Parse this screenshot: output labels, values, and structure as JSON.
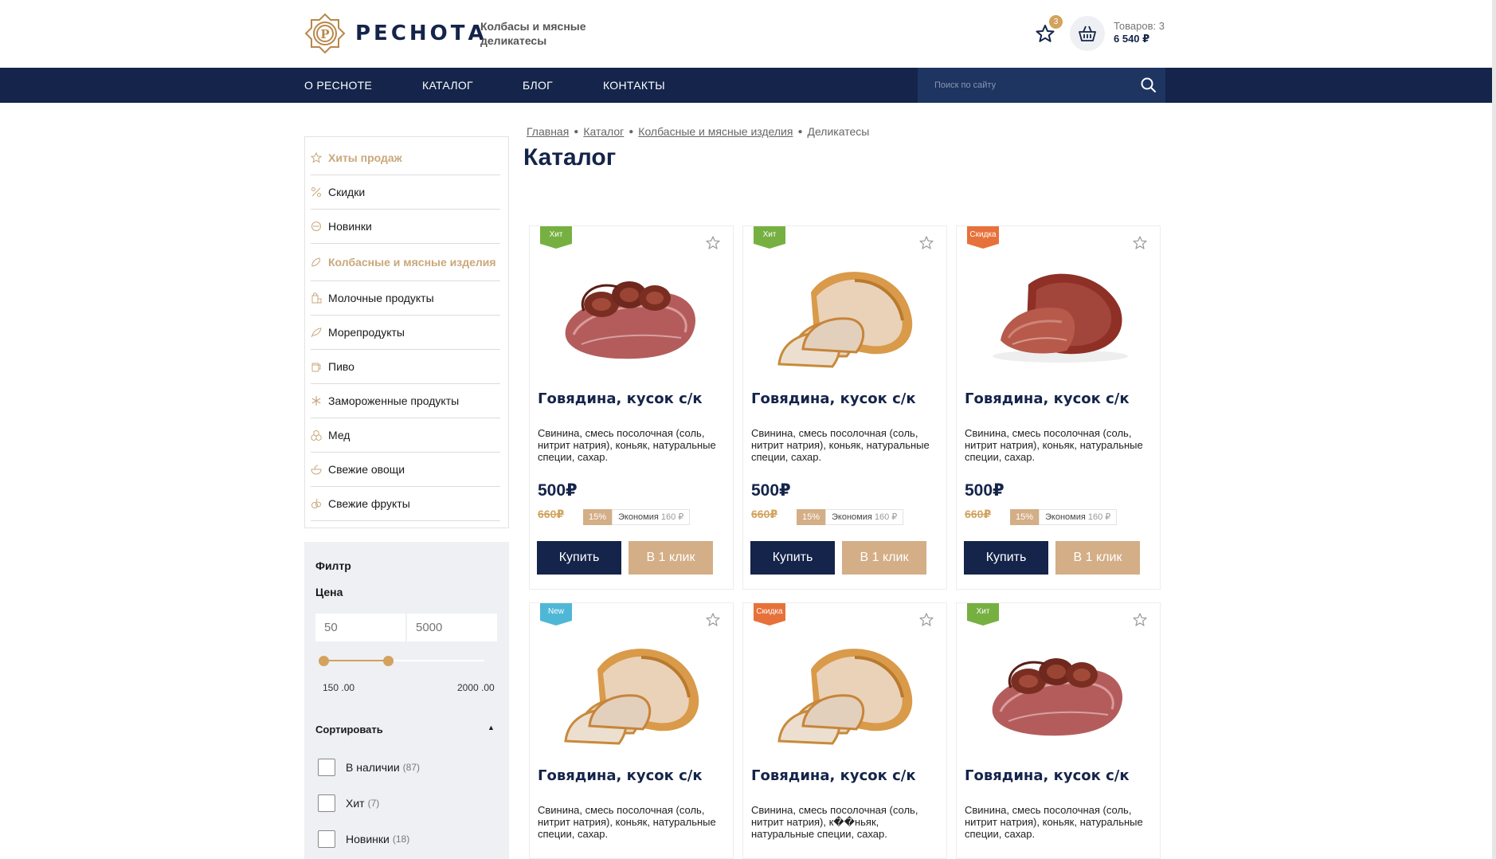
{
  "header": {
    "logo_text": "РЕСНОТА",
    "tagline": "Колбасы и мясные деликатесы",
    "favorites_count": "3",
    "cart_count": "Товаров: 3",
    "cart_sum": "6 540 ₽"
  },
  "nav": {
    "items": [
      "О РЕСНОТЕ",
      "КАТАЛОГ",
      "БЛОГ",
      "КОНТАКТЫ"
    ],
    "search_placeholder": "Поиск по сайту"
  },
  "sidebar": {
    "items": [
      {
        "label": "Хиты продаж",
        "icon": "star-icon",
        "accent": true
      },
      {
        "label": "Скидки",
        "icon": "percent-icon",
        "accent": false
      },
      {
        "label": "Новинки",
        "icon": "new-icon",
        "accent": false
      },
      {
        "label": "Колбасные и мясные изделия",
        "icon": "sausage-icon",
        "accent": true
      },
      {
        "label": "Молочные продукты",
        "icon": "milk-icon",
        "accent": false
      },
      {
        "label": "Морепродукты",
        "icon": "fish-icon",
        "accent": false
      },
      {
        "label": "Пиво",
        "icon": "beer-icon",
        "accent": false
      },
      {
        "label": "Замороженные продукты",
        "icon": "snowflake-icon",
        "accent": false
      },
      {
        "label": "Мед",
        "icon": "honey-icon",
        "accent": false
      },
      {
        "label": "Свежие овощи",
        "icon": "vegetables-icon",
        "accent": false
      },
      {
        "label": "Свежие фрукты",
        "icon": "fruits-icon",
        "accent": false
      }
    ]
  },
  "filter": {
    "title": "Филтр",
    "price_label": "Цена",
    "price_min_placeholder": "50",
    "price_max_placeholder": "5000",
    "slider_min_label": "150 .00",
    "slider_max_label": "2000 .00",
    "sort_label": "Сортировать",
    "checkboxes": [
      {
        "label": "В наличии",
        "count": "(87)"
      },
      {
        "label": "Хит",
        "count": "(7)"
      },
      {
        "label": "Новинки",
        "count": "(18)"
      }
    ]
  },
  "breadcrumb": [
    "Главная",
    "Каталог",
    "Колбасные и мясные изделия",
    "Деликатесы"
  ],
  "page_title": "Каталог",
  "products": [
    {
      "badge": "Хит",
      "badge_type": "hit",
      "image": "anchovy",
      "name": "Говядина, кусок с/к",
      "desc": "Свинина, смесь посолочная (соль, нитрит натрия), коньяк, натуральные специи, сахар.",
      "price": "500₽",
      "old_price": "660₽",
      "discount": "15%",
      "save_label": "Экономия",
      "save_amount": "160 ₽",
      "buy_label": "Купить",
      "oneclick_label": "В 1 клик"
    },
    {
      "badge": "Хит",
      "badge_type": "hit",
      "image": "ham",
      "name": "Говядина, кусок с/к",
      "desc": "Свинина, смесь посолочная (соль, нитрит натрия), коньяк, натуральные специи, сахар.",
      "price": "500₽",
      "old_price": "660₽",
      "discount": "15%",
      "save_label": "Экономия",
      "save_amount": "160 ₽",
      "buy_label": "Купить",
      "oneclick_label": "В 1 клик"
    },
    {
      "badge": "Скидка",
      "badge_type": "sale",
      "image": "beef",
      "name": "Говядина, кусок с/к",
      "desc": "Свинина, смесь посолочная (соль, нитрит натрия), коньяк, натуральные специи, сахар.",
      "price": "500₽",
      "old_price": "660₽",
      "discount": "15%",
      "save_label": "Экономия",
      "save_amount": "160 ₽",
      "buy_label": "Купить",
      "oneclick_label": "В 1 клик"
    },
    {
      "badge": "New",
      "badge_type": "new",
      "image": "ham",
      "name": "Говядина, кусок с/к",
      "desc": "Свинина, смесь посолочная (соль, нитрит натрия), коньяк, натуральные специи, сахар."
    },
    {
      "badge": "Скидка",
      "badge_type": "sale",
      "image": "ham",
      "name": "Говядина, кусок с/к",
      "desc": "Свинина, смесь посолочная (соль, нитрит натрия), к��ньяк, натуральные специи, сахар."
    },
    {
      "badge": "Хит",
      "badge_type": "hit",
      "image": "anchovy",
      "name": "Говядина, кусок с/к",
      "desc": "Свинина, смесь посолочная (соль, нитрит натрия), коньяк, натуральные специи, сахар."
    }
  ],
  "colors": {
    "navy": "#14244a",
    "gold": "#d3a25c",
    "beige_button": "#d3ae86",
    "badge_hit": "#76b041",
    "badge_sale": "#e7713a",
    "badge_new": "#4fb7d6"
  }
}
